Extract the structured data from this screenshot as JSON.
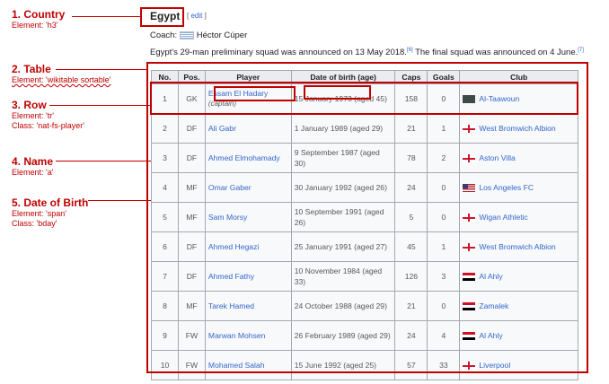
{
  "annotations": [
    {
      "title": "1. Country",
      "detail": "Element: 'h3'",
      "detail2": ""
    },
    {
      "title": "2. Table",
      "detail": "Element: 'wikitable sortable'",
      "detail2": ""
    },
    {
      "title": "3. Row",
      "detail": "Element: 'tr'",
      "detail2": "Class: 'nat-fs-player'"
    },
    {
      "title": "4. Name",
      "detail": "Element: 'a'",
      "detail2": ""
    },
    {
      "title": "5. Date of Birth",
      "detail": "Element: 'span'",
      "detail2": "Class: 'bday'"
    }
  ],
  "heading": "Egypt",
  "edit": "edit",
  "coach_label": "Coach:",
  "coach_name": "Héctor Cúper",
  "squad_text_1": "Egypt's 29-man preliminary squad was announced on 13 May 2018.",
  "squad_ref_1": "[6]",
  "squad_text_2": " The final squad was announced on 4 June.",
  "squad_ref_2": "[7]",
  "columns": [
    "No.",
    "Pos.",
    "Player",
    "Date of birth (age)",
    "Caps",
    "Goals",
    "Club"
  ],
  "rows": [
    {
      "no": "1",
      "pos": "GK",
      "player": "Essam El Hadary",
      "note": "(captain)",
      "dob": "15 January 1973 (aged 45)",
      "caps": "158",
      "goals": "0",
      "club": "Al-Taawoun",
      "flag": "sa"
    },
    {
      "no": "2",
      "pos": "DF",
      "player": "Ali Gabr",
      "note": "",
      "dob": "1 January 1989 (aged 29)",
      "caps": "21",
      "goals": "1",
      "club": "West Bromwich Albion",
      "flag": "en"
    },
    {
      "no": "3",
      "pos": "DF",
      "player": "Ahmed Elmohamady",
      "note": "",
      "dob": "9 September 1987 (aged 30)",
      "caps": "78",
      "goals": "2",
      "club": "Aston Villa",
      "flag": "en"
    },
    {
      "no": "4",
      "pos": "MF",
      "player": "Omar Gaber",
      "note": "",
      "dob": "30 January 1992 (aged 26)",
      "caps": "24",
      "goals": "0",
      "club": "Los Angeles FC",
      "flag": "us"
    },
    {
      "no": "5",
      "pos": "MF",
      "player": "Sam Morsy",
      "note": "",
      "dob": "10 September 1991 (aged 26)",
      "caps": "5",
      "goals": "0",
      "club": "Wigan Athletic",
      "flag": "en"
    },
    {
      "no": "6",
      "pos": "DF",
      "player": "Ahmed Hegazi",
      "note": "",
      "dob": "25 January 1991 (aged 27)",
      "caps": "45",
      "goals": "1",
      "club": "West Bromwich Albion",
      "flag": "en"
    },
    {
      "no": "7",
      "pos": "DF",
      "player": "Ahmed Fathy",
      "note": "",
      "dob": "10 November 1984 (aged 33)",
      "caps": "126",
      "goals": "3",
      "club": "Al Ahly",
      "flag": "eg"
    },
    {
      "no": "8",
      "pos": "MF",
      "player": "Tarek Hamed",
      "note": "",
      "dob": "24 October 1988 (aged 29)",
      "caps": "21",
      "goals": "0",
      "club": "Zamalek",
      "flag": "eg"
    },
    {
      "no": "9",
      "pos": "FW",
      "player": "Marwan Mohsen",
      "note": "",
      "dob": "26 February 1989 (aged 29)",
      "caps": "24",
      "goals": "4",
      "club": "Al Ahly",
      "flag": "eg"
    },
    {
      "no": "10",
      "pos": "FW",
      "player": "Mohamed Salah",
      "note": "",
      "dob": "15 June 1992 (aged 25)",
      "caps": "57",
      "goals": "33",
      "club": "Liverpool",
      "flag": "en"
    }
  ],
  "colors": {
    "annotation": "#c00000",
    "link": "#3366cc"
  }
}
